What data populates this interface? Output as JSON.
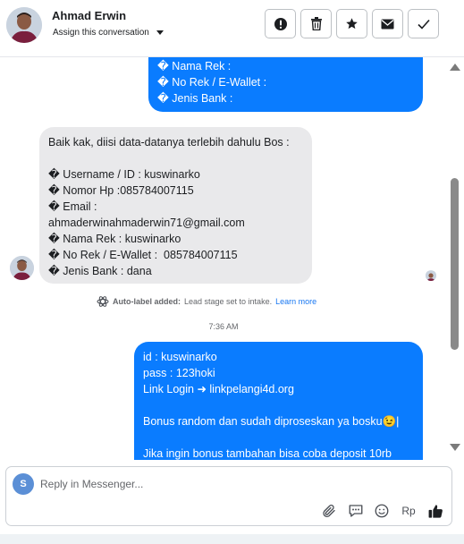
{
  "header": {
    "contact_name": "Ahmad Erwin",
    "assign_label": "Assign this conversation",
    "actions": [
      {
        "name": "mark-spam-button",
        "icon": "exclamation-icon"
      },
      {
        "name": "delete-button",
        "icon": "trash-icon"
      },
      {
        "name": "star-button",
        "icon": "star-icon"
      },
      {
        "name": "mark-unread-button",
        "icon": "envelope-icon"
      },
      {
        "name": "mark-done-button",
        "icon": "check-icon"
      }
    ]
  },
  "messages": [
    {
      "direction": "outgoing",
      "lines": [
        "� Nama Rek :",
        "� No Rek / E-Wallet :",
        "� Jenis Bank :"
      ]
    },
    {
      "direction": "incoming",
      "lines": [
        "Baik kak, diisi data-datanya terlebih dahulu Bos :",
        "",
        "� Username / ID : kuswinarko",
        "� Nomor Hp :085784007115",
        "� Email :",
        "ahmaderwinahmaderwin71@gmail.com",
        "� Nama Rek : kuswinarko",
        "� No Rek / E-Wallet :  085784007115",
        "� Jenis Bank : dana"
      ]
    },
    {
      "direction": "outgoing",
      "lines": [
        "id : kuswinarko",
        "pass : 123hoki",
        "Link Login ➜ linkpelangi4d.org",
        "",
        "Bonus random dan sudah diproseskan ya bosku😉|",
        "",
        "Jika ingin bonus tambahan bisa coba deposit 10rb"
      ]
    }
  ],
  "auto_label": {
    "title": "Auto-label added:",
    "text": "Lead stage set to intake.",
    "link": "Learn more"
  },
  "timestamp": "7:36 AM",
  "reply": {
    "avatar_letter": "S",
    "placeholder": "Reply in Messenger...",
    "currency_label": "Rp",
    "tools": [
      "paperclip-icon",
      "saved-reply-icon",
      "emoji-icon",
      "currency-icon",
      "thumbs-up-icon"
    ]
  },
  "colors": {
    "outgoing_bubble": "#0a7cff",
    "incoming_bubble": "#e9e9eb",
    "link": "#1877f2"
  }
}
